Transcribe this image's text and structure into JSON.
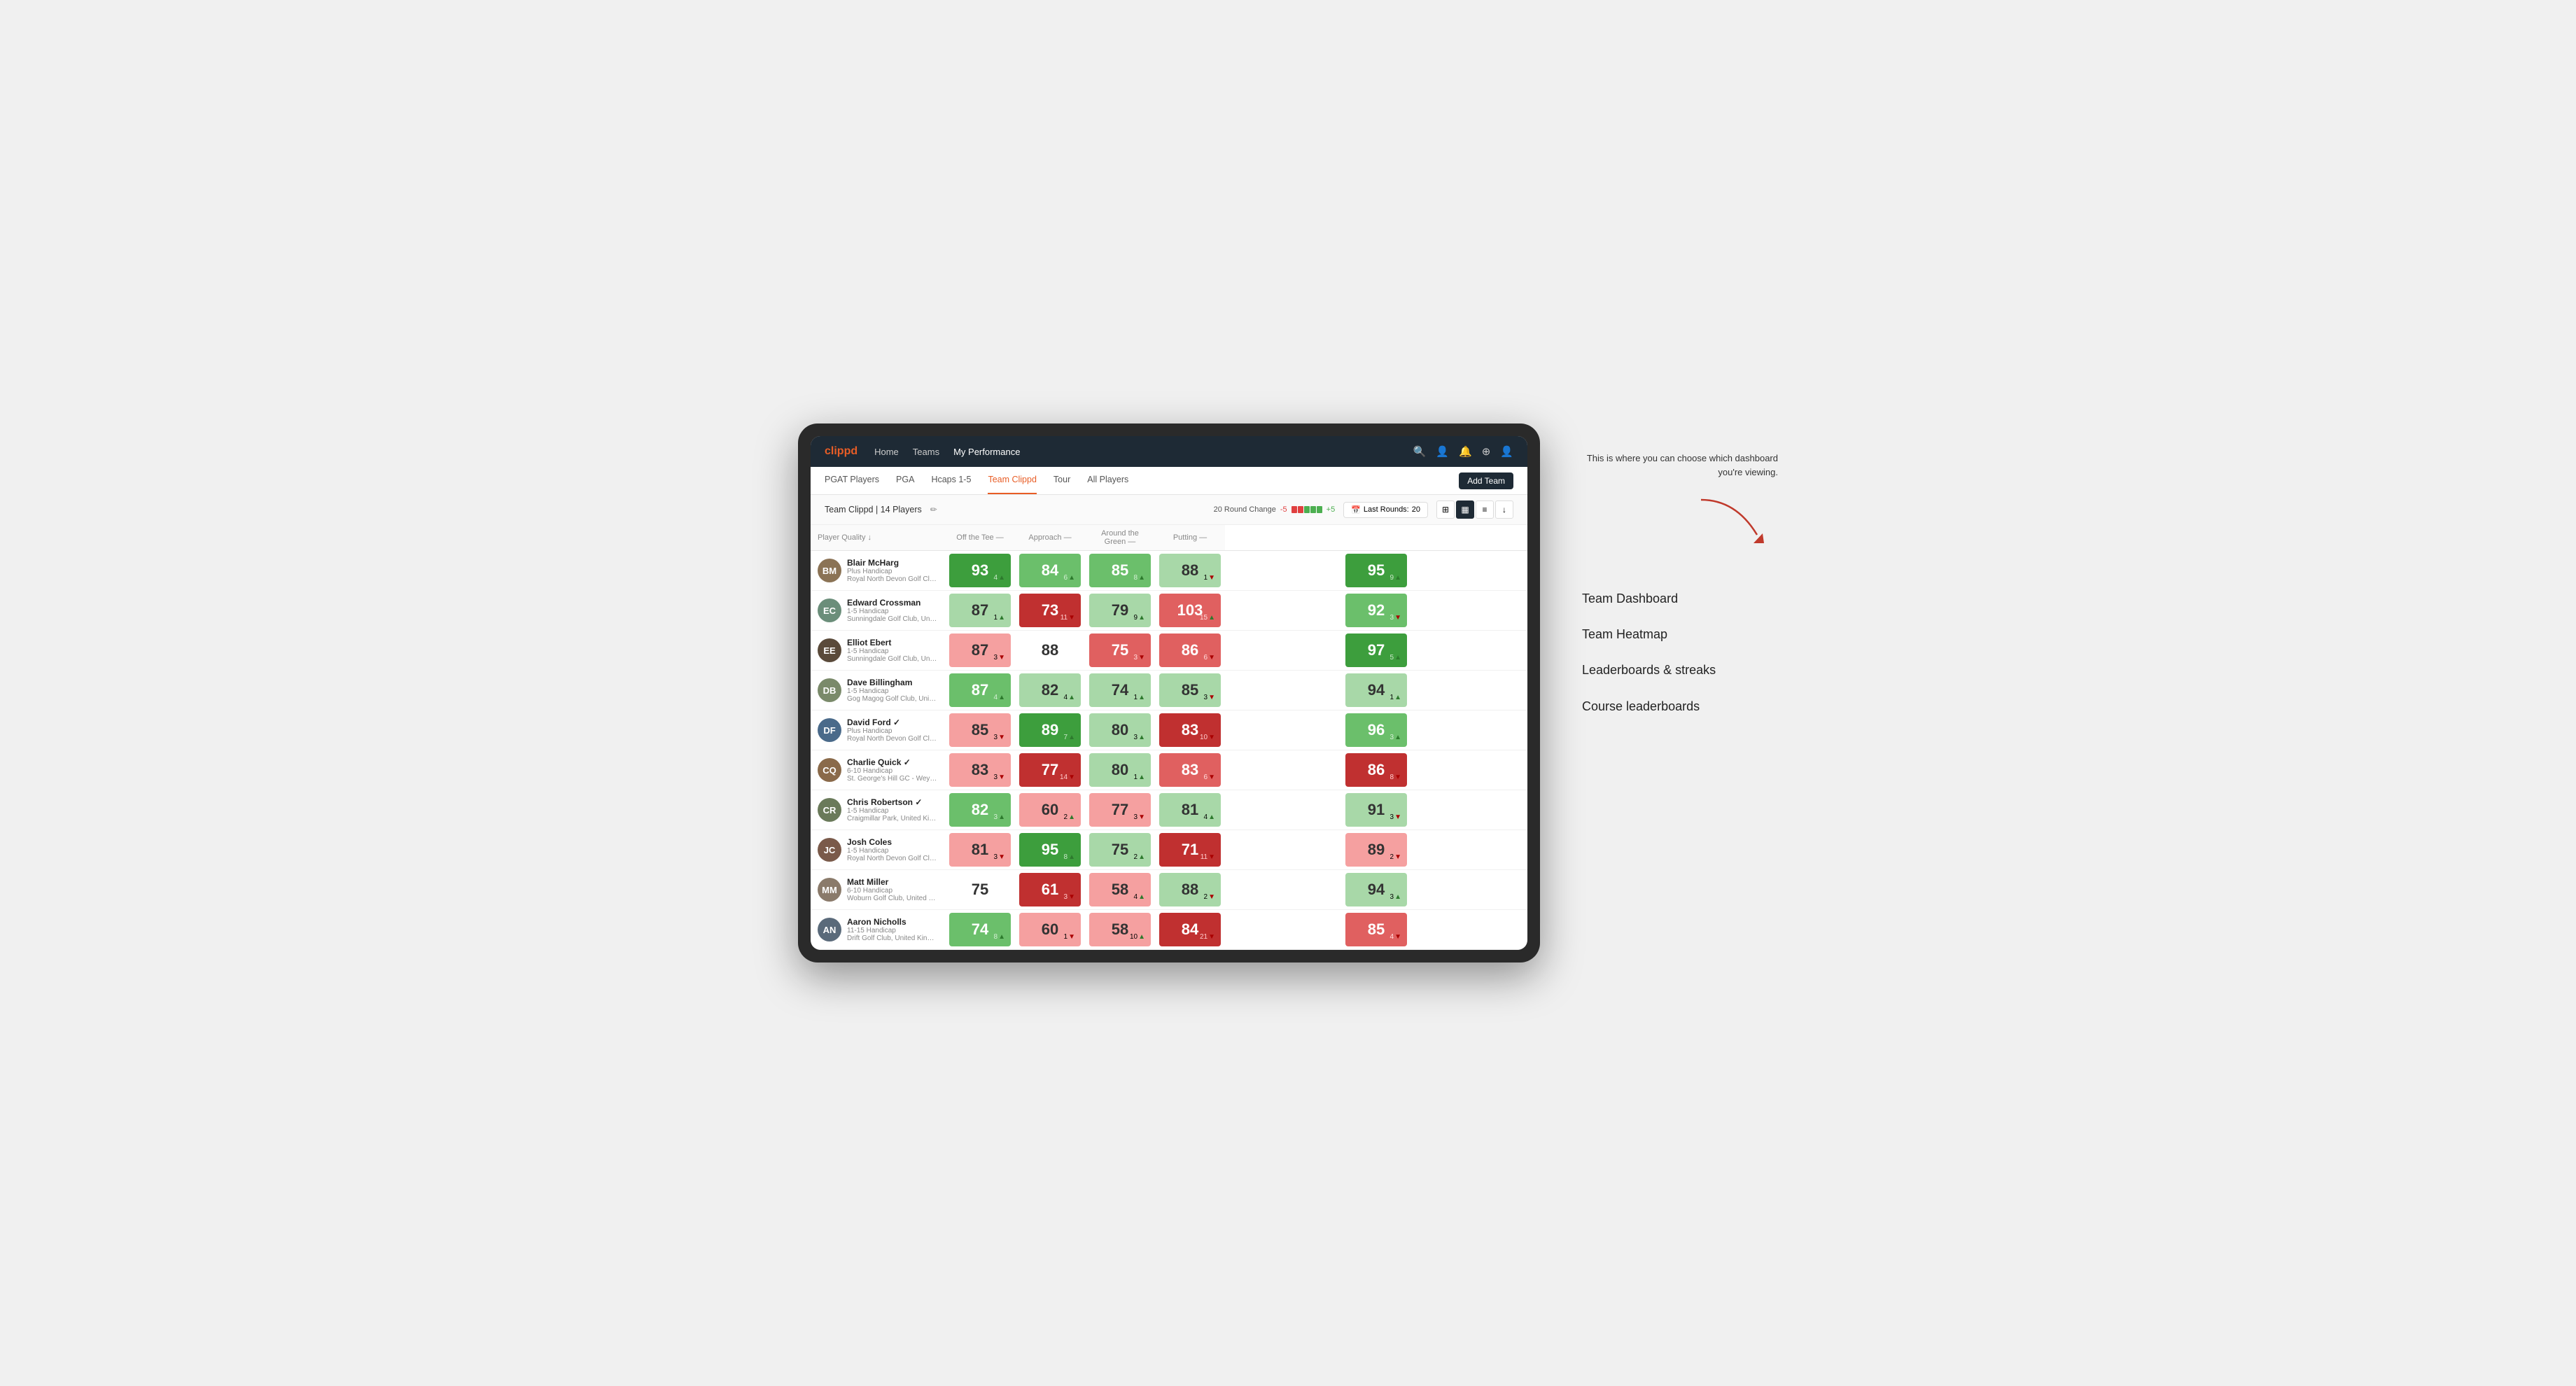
{
  "annotation": {
    "callout": "This is where you can choose which dashboard you're viewing.",
    "arrow_direction": "→",
    "items": [
      "Team Dashboard",
      "Team Heatmap",
      "Leaderboards & streaks",
      "Course leaderboards"
    ]
  },
  "nav": {
    "logo": "clippd",
    "links": [
      "Home",
      "Teams",
      "My Performance"
    ],
    "active_link": "My Performance",
    "icons": [
      "🔍",
      "👤",
      "🔔",
      "⊕",
      "👤"
    ]
  },
  "sub_nav": {
    "links": [
      "PGAT Players",
      "PGA",
      "Hcaps 1-5",
      "Team Clippd",
      "Tour",
      "All Players"
    ],
    "active": "Team Clippd",
    "add_team_label": "Add Team"
  },
  "team_header": {
    "name": "Team Clippd",
    "player_count": "14 Players",
    "round_change_label": "20 Round Change",
    "change_neg": "-5",
    "change_pos": "+5",
    "last_rounds_label": "Last Rounds:",
    "last_rounds_value": "20"
  },
  "table": {
    "columns": {
      "player": "Player Quality ↓",
      "off_tee": "Off the Tee —",
      "approach": "Approach —",
      "around_green": "Around the Green —",
      "putting": "Putting —"
    },
    "rows": [
      {
        "name": "Blair McHarg",
        "handicap": "Plus Handicap",
        "club": "Royal North Devon Golf Club, United Kingdom",
        "avatar_color": "#8B7355",
        "initials": "BM",
        "player_quality": {
          "value": 93,
          "change": "+4",
          "direction": "up",
          "color": "green-strong"
        },
        "off_tee": {
          "value": 84,
          "change": "+6",
          "direction": "up",
          "color": "green-medium"
        },
        "approach": {
          "value": 85,
          "change": "+8",
          "direction": "up",
          "color": "green-medium"
        },
        "around_green": {
          "value": 88,
          "change": "-1",
          "direction": "down",
          "color": "green-light"
        },
        "putting": {
          "value": 95,
          "change": "+9",
          "direction": "up",
          "color": "green-strong"
        }
      },
      {
        "name": "Edward Crossman",
        "handicap": "1-5 Handicap",
        "club": "Sunningdale Golf Club, United Kingdom",
        "avatar_color": "#6B8E7A",
        "initials": "EC",
        "player_quality": {
          "value": 87,
          "change": "+1",
          "direction": "up",
          "color": "green-light"
        },
        "off_tee": {
          "value": 73,
          "change": "-11",
          "direction": "down",
          "color": "red-strong"
        },
        "approach": {
          "value": 79,
          "change": "+9",
          "direction": "up",
          "color": "green-light"
        },
        "around_green": {
          "value": 103,
          "change": "+15",
          "direction": "up",
          "color": "red-medium"
        },
        "putting": {
          "value": 92,
          "change": "-3",
          "direction": "down",
          "color": "green-medium"
        }
      },
      {
        "name": "Elliot Ebert",
        "handicap": "1-5 Handicap",
        "club": "Sunningdale Golf Club, United Kingdom",
        "avatar_color": "#5a4a3a",
        "initials": "EE",
        "player_quality": {
          "value": 87,
          "change": "-3",
          "direction": "down",
          "color": "red-light"
        },
        "off_tee": {
          "value": 88,
          "change": "",
          "direction": "",
          "color": "white"
        },
        "approach": {
          "value": 75,
          "change": "-3",
          "direction": "down",
          "color": "red-medium"
        },
        "around_green": {
          "value": 86,
          "change": "-6",
          "direction": "down",
          "color": "red-medium"
        },
        "putting": {
          "value": 97,
          "change": "+5",
          "direction": "up",
          "color": "green-strong"
        }
      },
      {
        "name": "Dave Billingham",
        "handicap": "1-5 Handicap",
        "club": "Gog Magog Golf Club, United Kingdom",
        "avatar_color": "#7a8a6a",
        "initials": "DB",
        "player_quality": {
          "value": 87,
          "change": "+4",
          "direction": "up",
          "color": "green-medium"
        },
        "off_tee": {
          "value": 82,
          "change": "+4",
          "direction": "up",
          "color": "green-light"
        },
        "approach": {
          "value": 74,
          "change": "+1",
          "direction": "up",
          "color": "green-light"
        },
        "around_green": {
          "value": 85,
          "change": "-3",
          "direction": "down",
          "color": "green-light"
        },
        "putting": {
          "value": 94,
          "change": "+1",
          "direction": "up",
          "color": "green-light"
        }
      },
      {
        "name": "David Ford ✓",
        "handicap": "Plus Handicap",
        "club": "Royal North Devon Golf Club, United Kingdom",
        "avatar_color": "#4a6a8a",
        "initials": "DF",
        "player_quality": {
          "value": 85,
          "change": "-3",
          "direction": "down",
          "color": "red-light"
        },
        "off_tee": {
          "value": 89,
          "change": "+7",
          "direction": "up",
          "color": "green-strong"
        },
        "approach": {
          "value": 80,
          "change": "+3",
          "direction": "up",
          "color": "green-light"
        },
        "around_green": {
          "value": 83,
          "change": "-10",
          "direction": "down",
          "color": "red-strong"
        },
        "putting": {
          "value": 96,
          "change": "+3",
          "direction": "up",
          "color": "green-medium"
        }
      },
      {
        "name": "Charlie Quick ✓",
        "handicap": "6-10 Handicap",
        "club": "St. George's Hill GC - Weybridge, Surrey, Uni...",
        "avatar_color": "#8a6a4a",
        "initials": "CQ",
        "player_quality": {
          "value": 83,
          "change": "-3",
          "direction": "down",
          "color": "red-light"
        },
        "off_tee": {
          "value": 77,
          "change": "-14",
          "direction": "down",
          "color": "red-strong"
        },
        "approach": {
          "value": 80,
          "change": "+1",
          "direction": "up",
          "color": "green-light"
        },
        "around_green": {
          "value": 83,
          "change": "-6",
          "direction": "down",
          "color": "red-medium"
        },
        "putting": {
          "value": 86,
          "change": "-8",
          "direction": "down",
          "color": "red-strong"
        }
      },
      {
        "name": "Chris Robertson ✓",
        "handicap": "1-5 Handicap",
        "club": "Craigmillar Park, United Kingdom",
        "avatar_color": "#6a7a5a",
        "initials": "CR",
        "player_quality": {
          "value": 82,
          "change": "+3",
          "direction": "up",
          "color": "green-medium"
        },
        "off_tee": {
          "value": 60,
          "change": "+2",
          "direction": "up",
          "color": "red-light"
        },
        "approach": {
          "value": 77,
          "change": "-3",
          "direction": "down",
          "color": "red-light"
        },
        "around_green": {
          "value": 81,
          "change": "+4",
          "direction": "up",
          "color": "green-light"
        },
        "putting": {
          "value": 91,
          "change": "-3",
          "direction": "down",
          "color": "green-light"
        }
      },
      {
        "name": "Josh Coles",
        "handicap": "1-5 Handicap",
        "club": "Royal North Devon Golf Club, United Kingdom",
        "avatar_color": "#7a5a4a",
        "initials": "JC",
        "player_quality": {
          "value": 81,
          "change": "-3",
          "direction": "down",
          "color": "red-light"
        },
        "off_tee": {
          "value": 95,
          "change": "+8",
          "direction": "up",
          "color": "green-strong"
        },
        "approach": {
          "value": 75,
          "change": "+2",
          "direction": "up",
          "color": "green-light"
        },
        "around_green": {
          "value": 71,
          "change": "-11",
          "direction": "down",
          "color": "red-strong"
        },
        "putting": {
          "value": 89,
          "change": "-2",
          "direction": "down",
          "color": "red-light"
        }
      },
      {
        "name": "Matt Miller",
        "handicap": "6-10 Handicap",
        "club": "Woburn Golf Club, United Kingdom",
        "avatar_color": "#8a7a6a",
        "initials": "MM",
        "player_quality": {
          "value": 75,
          "change": "",
          "direction": "",
          "color": "white"
        },
        "off_tee": {
          "value": 61,
          "change": "-3",
          "direction": "down",
          "color": "red-strong"
        },
        "approach": {
          "value": 58,
          "change": "+4",
          "direction": "up",
          "color": "red-light"
        },
        "around_green": {
          "value": 88,
          "change": "-2",
          "direction": "down",
          "color": "green-light"
        },
        "putting": {
          "value": 94,
          "change": "+3",
          "direction": "up",
          "color": "green-light"
        }
      },
      {
        "name": "Aaron Nicholls",
        "handicap": "11-15 Handicap",
        "club": "Drift Golf Club, United Kingdom",
        "avatar_color": "#5a6a7a",
        "initials": "AN",
        "player_quality": {
          "value": 74,
          "change": "+8",
          "direction": "up",
          "color": "green-medium"
        },
        "off_tee": {
          "value": 60,
          "change": "-1",
          "direction": "down",
          "color": "red-light"
        },
        "approach": {
          "value": 58,
          "change": "+10",
          "direction": "up",
          "color": "red-light"
        },
        "around_green": {
          "value": 84,
          "change": "-21",
          "direction": "down",
          "color": "red-strong"
        },
        "putting": {
          "value": 85,
          "change": "-4",
          "direction": "down",
          "color": "red-medium"
        }
      }
    ]
  }
}
